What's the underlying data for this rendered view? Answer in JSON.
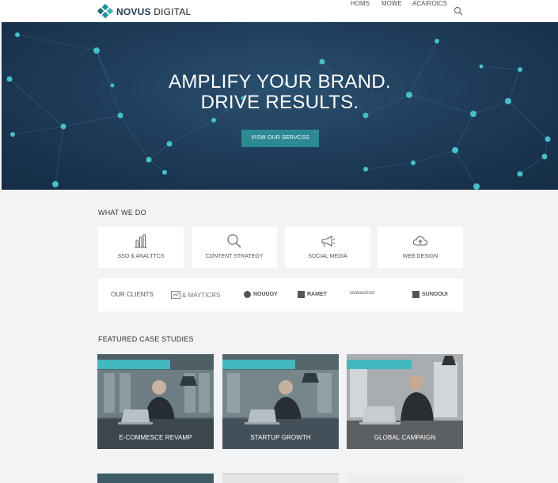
{
  "header": {
    "brand_bold": "NOVUS",
    "brand_rest": " DIGITAL",
    "nav": [
      "HOMS",
      "MOWE",
      "ACAIROICS"
    ]
  },
  "hero": {
    "title_line1": "AMPLIFY YOUR BRAND.",
    "title_line2": "DRIVE RESULTS.",
    "button": "VISW OUR SERVCSS"
  },
  "services": {
    "heading": "WHAT WE DO",
    "items": [
      {
        "label": "SSO & ANALTTCS",
        "icon": "bar-chart-icon"
      },
      {
        "label": "CONTENT STRATEGY",
        "icon": "magnifier-icon"
      },
      {
        "label": "SOCIAL MEDIA",
        "icon": "megaphone-icon"
      },
      {
        "label": "WEB DESIGN",
        "icon": "cloud-icon"
      }
    ]
  },
  "clients": {
    "label": "OUR CLIENTS",
    "logos": [
      "& MAYTICRS",
      "NOUUOY",
      "RAMET",
      "ccoloxcnnct",
      "SUNOOUI"
    ]
  },
  "case_studies": {
    "heading": "FEATURED CASE STUDIES",
    "items": [
      "E-COMMESCE REVAMP",
      "STARTUP GROWTH",
      "GLOBAL CAMPAIGN"
    ]
  },
  "colors": {
    "accent": "#2b8a93",
    "hero_bg": "#1d3a57",
    "stripe": "#43b8bd"
  }
}
